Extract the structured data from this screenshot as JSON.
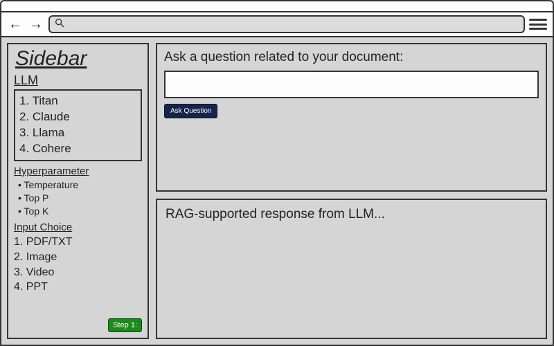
{
  "toolbar": {
    "search_value": ""
  },
  "sidebar": {
    "title": "Sidebar",
    "llm_label": "LLM",
    "llm_items": [
      "Titan",
      "Claude",
      "Llama",
      "Cohere"
    ],
    "hyper_label": "Hyperparameter",
    "hyper_items": [
      "Temperature",
      "Top P",
      "Top K"
    ],
    "input_label": "Input Choice",
    "input_items": [
      "PDF/TXT",
      "Image",
      "Video",
      "PPT"
    ],
    "step_badge": "Step 1:"
  },
  "ask": {
    "prompt": "Ask a question related to your document:",
    "input_value": "",
    "button_label": "Ask Question"
  },
  "response": {
    "text": "RAG-supported response from LLM..."
  }
}
